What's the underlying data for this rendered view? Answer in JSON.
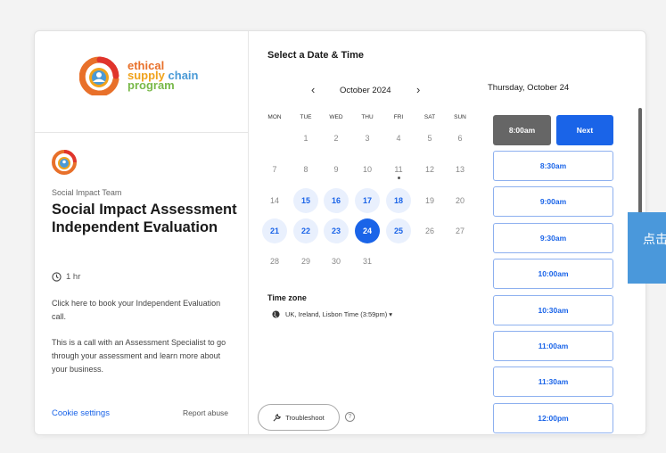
{
  "org": {
    "logo_line1": "ethical",
    "logo_line2a": "supply",
    "logo_line2b": "chain",
    "logo_line3": "program"
  },
  "event": {
    "team": "Social Impact Team",
    "title": "Social Impact Assessment Independent Evaluation",
    "duration": "1 hr",
    "description1": "Click here to book your Independent Evaluation call.",
    "description2": "This is a call with an Assessment Specialist to go through your assessment and learn more about your business."
  },
  "footer": {
    "cookie": "Cookie settings",
    "report": "Report abuse"
  },
  "scheduler": {
    "title": "Select a Date & Time",
    "month": "October 2024",
    "prev": "‹",
    "next": "›",
    "weekdays": [
      "MON",
      "TUE",
      "WED",
      "THU",
      "FRI",
      "SAT",
      "SUN"
    ],
    "weeks": [
      [
        "",
        "1",
        "2",
        "3",
        "4",
        "5",
        "6"
      ],
      [
        "7",
        "8",
        "9",
        "10",
        "11",
        "12",
        "13"
      ],
      [
        "14",
        "15",
        "16",
        "17",
        "18",
        "19",
        "20"
      ],
      [
        "21",
        "22",
        "23",
        "24",
        "25",
        "26",
        "27"
      ],
      [
        "28",
        "29",
        "30",
        "31",
        "",
        "",
        ""
      ]
    ],
    "available_days": [
      "15",
      "16",
      "17",
      "18",
      "21",
      "22",
      "23",
      "25"
    ],
    "selected_day": "24",
    "today_dot_day": "11",
    "timezone_label": "Time zone",
    "timezone_value": "UK, Ireland, Lisbon Time (3:59pm) ▾",
    "troubleshoot": "Troubleshoot",
    "selected_date": "Thursday, October 24",
    "selected_slot": "8:00am",
    "next_button": "Next",
    "slots": [
      "8:30am",
      "9:00am",
      "9:30am",
      "10:00am",
      "10:30am",
      "11:00am",
      "11:30am",
      "12:00pm"
    ]
  },
  "side_tab": "点击",
  "colors": {
    "accent": "#1a64e8",
    "available_bg": "#e9f0fd",
    "side_tab": "#4a98db"
  }
}
